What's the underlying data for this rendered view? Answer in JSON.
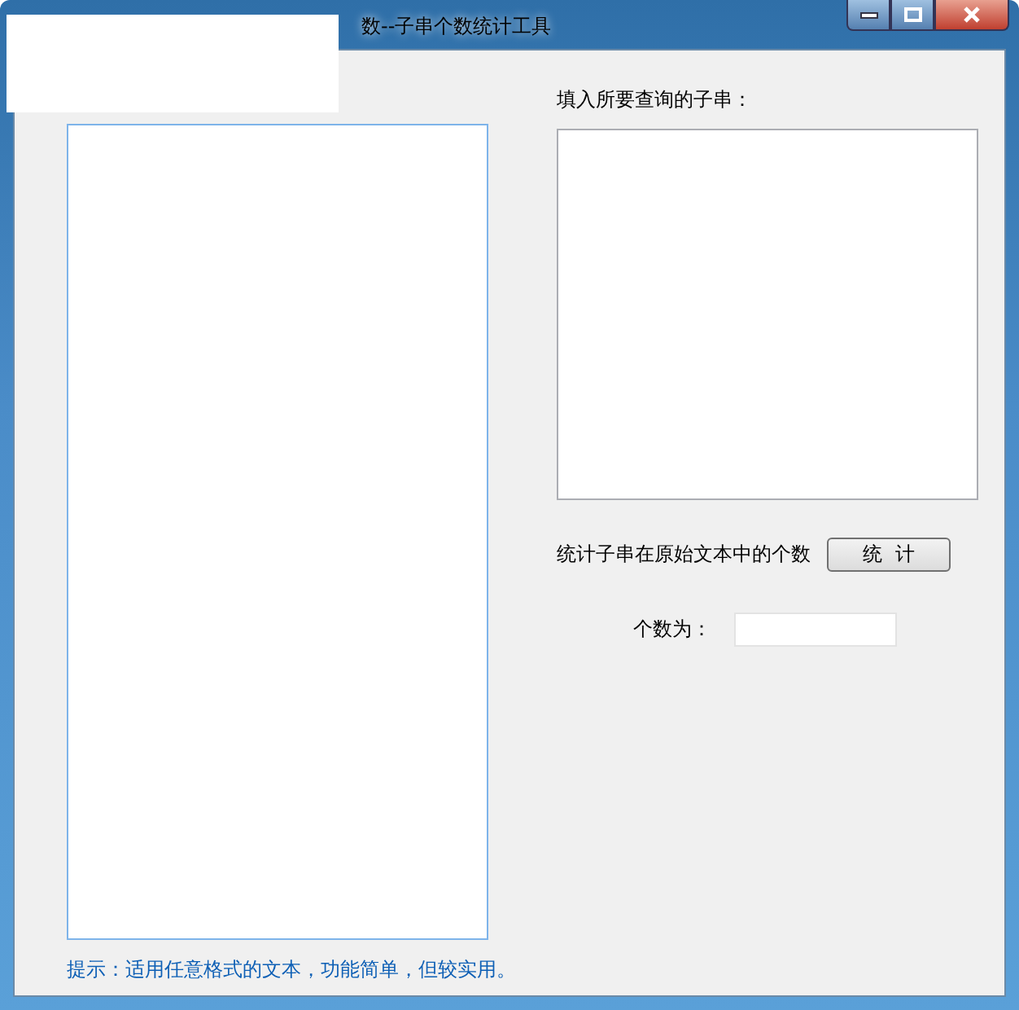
{
  "window": {
    "title": "数--子串个数统计工具",
    "buttons": [
      {
        "kind": "minimize"
      },
      {
        "kind": "maximize"
      },
      {
        "kind": "close"
      }
    ]
  },
  "query": {
    "label": "填入所要查询的子串："
  },
  "count_row": {
    "label": "统计子串在原始文本中的个数",
    "button": "统  计"
  },
  "result": {
    "label": "个数为："
  },
  "hint": "提示：适用任意格式的文本，功能简单，但较实用。"
}
